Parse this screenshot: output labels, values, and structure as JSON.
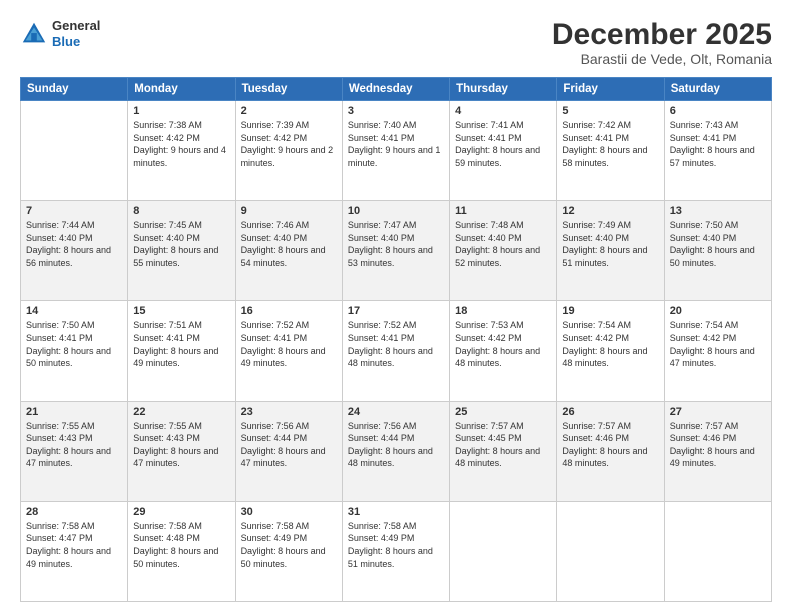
{
  "header": {
    "logo_line1": "General",
    "logo_line2": "Blue",
    "title": "December 2025",
    "subtitle": "Barastii de Vede, Olt, Romania"
  },
  "days_of_week": [
    "Sunday",
    "Monday",
    "Tuesday",
    "Wednesday",
    "Thursday",
    "Friday",
    "Saturday"
  ],
  "weeks": [
    [
      {
        "day": "",
        "sunrise": "",
        "sunset": "",
        "daylight": ""
      },
      {
        "day": "1",
        "sunrise": "Sunrise: 7:38 AM",
        "sunset": "Sunset: 4:42 PM",
        "daylight": "Daylight: 9 hours and 4 minutes."
      },
      {
        "day": "2",
        "sunrise": "Sunrise: 7:39 AM",
        "sunset": "Sunset: 4:42 PM",
        "daylight": "Daylight: 9 hours and 2 minutes."
      },
      {
        "day": "3",
        "sunrise": "Sunrise: 7:40 AM",
        "sunset": "Sunset: 4:41 PM",
        "daylight": "Daylight: 9 hours and 1 minute."
      },
      {
        "day": "4",
        "sunrise": "Sunrise: 7:41 AM",
        "sunset": "Sunset: 4:41 PM",
        "daylight": "Daylight: 8 hours and 59 minutes."
      },
      {
        "day": "5",
        "sunrise": "Sunrise: 7:42 AM",
        "sunset": "Sunset: 4:41 PM",
        "daylight": "Daylight: 8 hours and 58 minutes."
      },
      {
        "day": "6",
        "sunrise": "Sunrise: 7:43 AM",
        "sunset": "Sunset: 4:41 PM",
        "daylight": "Daylight: 8 hours and 57 minutes."
      }
    ],
    [
      {
        "day": "7",
        "sunrise": "Sunrise: 7:44 AM",
        "sunset": "Sunset: 4:40 PM",
        "daylight": "Daylight: 8 hours and 56 minutes."
      },
      {
        "day": "8",
        "sunrise": "Sunrise: 7:45 AM",
        "sunset": "Sunset: 4:40 PM",
        "daylight": "Daylight: 8 hours and 55 minutes."
      },
      {
        "day": "9",
        "sunrise": "Sunrise: 7:46 AM",
        "sunset": "Sunset: 4:40 PM",
        "daylight": "Daylight: 8 hours and 54 minutes."
      },
      {
        "day": "10",
        "sunrise": "Sunrise: 7:47 AM",
        "sunset": "Sunset: 4:40 PM",
        "daylight": "Daylight: 8 hours and 53 minutes."
      },
      {
        "day": "11",
        "sunrise": "Sunrise: 7:48 AM",
        "sunset": "Sunset: 4:40 PM",
        "daylight": "Daylight: 8 hours and 52 minutes."
      },
      {
        "day": "12",
        "sunrise": "Sunrise: 7:49 AM",
        "sunset": "Sunset: 4:40 PM",
        "daylight": "Daylight: 8 hours and 51 minutes."
      },
      {
        "day": "13",
        "sunrise": "Sunrise: 7:50 AM",
        "sunset": "Sunset: 4:40 PM",
        "daylight": "Daylight: 8 hours and 50 minutes."
      }
    ],
    [
      {
        "day": "14",
        "sunrise": "Sunrise: 7:50 AM",
        "sunset": "Sunset: 4:41 PM",
        "daylight": "Daylight: 8 hours and 50 minutes."
      },
      {
        "day": "15",
        "sunrise": "Sunrise: 7:51 AM",
        "sunset": "Sunset: 4:41 PM",
        "daylight": "Daylight: 8 hours and 49 minutes."
      },
      {
        "day": "16",
        "sunrise": "Sunrise: 7:52 AM",
        "sunset": "Sunset: 4:41 PM",
        "daylight": "Daylight: 8 hours and 49 minutes."
      },
      {
        "day": "17",
        "sunrise": "Sunrise: 7:52 AM",
        "sunset": "Sunset: 4:41 PM",
        "daylight": "Daylight: 8 hours and 48 minutes."
      },
      {
        "day": "18",
        "sunrise": "Sunrise: 7:53 AM",
        "sunset": "Sunset: 4:42 PM",
        "daylight": "Daylight: 8 hours and 48 minutes."
      },
      {
        "day": "19",
        "sunrise": "Sunrise: 7:54 AM",
        "sunset": "Sunset: 4:42 PM",
        "daylight": "Daylight: 8 hours and 48 minutes."
      },
      {
        "day": "20",
        "sunrise": "Sunrise: 7:54 AM",
        "sunset": "Sunset: 4:42 PM",
        "daylight": "Daylight: 8 hours and 47 minutes."
      }
    ],
    [
      {
        "day": "21",
        "sunrise": "Sunrise: 7:55 AM",
        "sunset": "Sunset: 4:43 PM",
        "daylight": "Daylight: 8 hours and 47 minutes."
      },
      {
        "day": "22",
        "sunrise": "Sunrise: 7:55 AM",
        "sunset": "Sunset: 4:43 PM",
        "daylight": "Daylight: 8 hours and 47 minutes."
      },
      {
        "day": "23",
        "sunrise": "Sunrise: 7:56 AM",
        "sunset": "Sunset: 4:44 PM",
        "daylight": "Daylight: 8 hours and 47 minutes."
      },
      {
        "day": "24",
        "sunrise": "Sunrise: 7:56 AM",
        "sunset": "Sunset: 4:44 PM",
        "daylight": "Daylight: 8 hours and 48 minutes."
      },
      {
        "day": "25",
        "sunrise": "Sunrise: 7:57 AM",
        "sunset": "Sunset: 4:45 PM",
        "daylight": "Daylight: 8 hours and 48 minutes."
      },
      {
        "day": "26",
        "sunrise": "Sunrise: 7:57 AM",
        "sunset": "Sunset: 4:46 PM",
        "daylight": "Daylight: 8 hours and 48 minutes."
      },
      {
        "day": "27",
        "sunrise": "Sunrise: 7:57 AM",
        "sunset": "Sunset: 4:46 PM",
        "daylight": "Daylight: 8 hours and 49 minutes."
      }
    ],
    [
      {
        "day": "28",
        "sunrise": "Sunrise: 7:58 AM",
        "sunset": "Sunset: 4:47 PM",
        "daylight": "Daylight: 8 hours and 49 minutes."
      },
      {
        "day": "29",
        "sunrise": "Sunrise: 7:58 AM",
        "sunset": "Sunset: 4:48 PM",
        "daylight": "Daylight: 8 hours and 50 minutes."
      },
      {
        "day": "30",
        "sunrise": "Sunrise: 7:58 AM",
        "sunset": "Sunset: 4:49 PM",
        "daylight": "Daylight: 8 hours and 50 minutes."
      },
      {
        "day": "31",
        "sunrise": "Sunrise: 7:58 AM",
        "sunset": "Sunset: 4:49 PM",
        "daylight": "Daylight: 8 hours and 51 minutes."
      },
      {
        "day": "",
        "sunrise": "",
        "sunset": "",
        "daylight": ""
      },
      {
        "day": "",
        "sunrise": "",
        "sunset": "",
        "daylight": ""
      },
      {
        "day": "",
        "sunrise": "",
        "sunset": "",
        "daylight": ""
      }
    ]
  ]
}
